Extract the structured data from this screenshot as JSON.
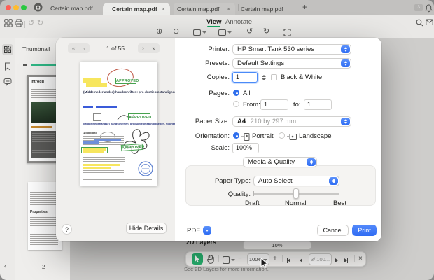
{
  "titlebar": {
    "window_title": "Certain map.pdf",
    "tabs": [
      {
        "label": "Certain map.pdf",
        "active": true
      },
      {
        "label": "Certain map.pdf",
        "active": false
      },
      {
        "label": "Certain map.pdf",
        "active": false
      }
    ],
    "badge": "3"
  },
  "toolbar": {
    "view_tab": "View",
    "annotate_tab": "Annotate"
  },
  "sidebar": {
    "panel_title": "Thumbnail",
    "thumb1_heading": "Introdu",
    "thumb2_heading": "Properties",
    "page2_label": "2"
  },
  "dialog": {
    "nav": {
      "page_indicator": "1 of 55"
    },
    "preview": {
      "title": "(Middelnederlandse) handschriften: pro-ductieomstandigheden, soorten, functies",
      "subtitle": "(Middelnederlandse) handschriften: productieomstandigheden, soorten, functies",
      "section_heading": "1 Inleiding",
      "stamp_text": "APPROVED"
    },
    "printer": {
      "label": "Printer:",
      "value": "HP Smart Tank 530 series"
    },
    "presets": {
      "label": "Presets:",
      "value": "Default Settings"
    },
    "copies": {
      "label": "Copies:",
      "value": "1",
      "bw_label": "Black & White"
    },
    "pages": {
      "label": "Pages:",
      "all_label": "All",
      "from_label": "From:",
      "from_value": "1",
      "to_label": "to:",
      "to_value": "1"
    },
    "paper_size": {
      "label": "Paper Size:",
      "value": "A4",
      "detail": "210 by 297 mm"
    },
    "orientation": {
      "label": "Orientation:",
      "portrait": "Portrait",
      "landscape": "Landscape"
    },
    "scale": {
      "label": "Scale:",
      "value": "100%"
    },
    "media_quality": {
      "section": "Media & Quality",
      "paper_type_label": "Paper Type:",
      "paper_type_value": "Auto Select",
      "quality_label": "Quality:",
      "ticks": [
        "Draft",
        "Normal",
        "Best"
      ]
    },
    "footer": {
      "hide_details": "Hide Details",
      "pdf": "PDF",
      "cancel": "Cancel",
      "print": "Print"
    }
  },
  "statusbar": {
    "layers_title": "2D Layers",
    "opacity_value": "10%",
    "zoom_value": "100%",
    "page_value": "3/ 100...",
    "info_text": "See 2D Layers for more information."
  },
  "icons": {
    "close": "×",
    "plus": "+",
    "minus": "−",
    "zoom_in": "⊕",
    "zoom_out": "⊖",
    "undo": "↺",
    "redo": "↻",
    "back_first": "«",
    "back": "‹",
    "fwd": "›",
    "fwd_last": "»",
    "help": "?",
    "collapse": "‹"
  },
  "colors": {
    "accent_blue": "#3577f7",
    "green": "#14a45f",
    "stamp_green": "#3f9b47",
    "print_blue": "#3d7bfd"
  }
}
